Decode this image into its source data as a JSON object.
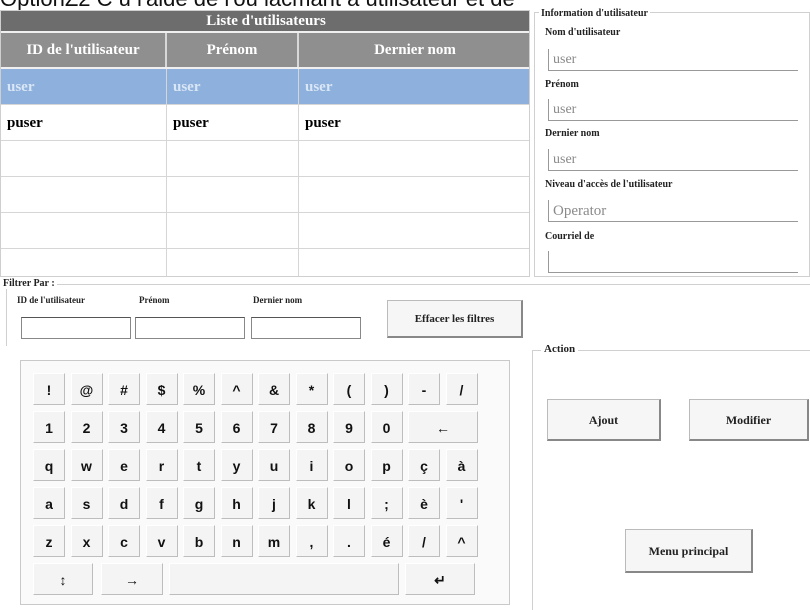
{
  "caption": "OptionZ2 C u l'aide de l'ou lacmant a utilisateur et de",
  "users_list": {
    "title": "Liste d'utilisateurs",
    "columns": [
      "ID de l'utilisateur",
      "Prénom",
      "Dernier nom"
    ],
    "rows": [
      [
        "user",
        "user",
        "user"
      ],
      [
        "puser",
        "puser",
        "puser"
      ],
      [
        "",
        "",
        ""
      ],
      [
        "",
        "",
        ""
      ],
      [
        "",
        "",
        ""
      ],
      [
        "",
        "",
        ""
      ]
    ],
    "selected_row": 0
  },
  "user_info": {
    "legend": "Information d'utilisateur",
    "username_label": "Nom d'utilisateur",
    "username_value": "user",
    "firstname_label": "Prénom",
    "firstname_value": "user",
    "lastname_label": "Dernier nom",
    "lastname_value": "user",
    "access_label": "Niveau d'accès de l'utilisateur",
    "access_value": "Operator",
    "email_label": "Courriel de",
    "email_value": ""
  },
  "filter": {
    "legend": "Filtrer Par :",
    "id_label": "ID de l'utilisateur",
    "firstname_label": "Prénom",
    "lastname_label": "Dernier nom",
    "id_value": "",
    "firstname_value": "",
    "lastname_value": "",
    "clear_label": "Effacer les filtres"
  },
  "keyboard": {
    "rows": [
      [
        "!",
        "@",
        "#",
        "$",
        "%",
        "^",
        "&",
        "*",
        "(",
        ")",
        "-",
        "/"
      ],
      [
        "1",
        "2",
        "3",
        "4",
        "5",
        "6",
        "7",
        "8",
        "9",
        "0",
        "←"
      ],
      [
        "q",
        "w",
        "e",
        "r",
        "t",
        "y",
        "u",
        "i",
        "o",
        "p",
        "ç",
        "à"
      ],
      [
        "a",
        "s",
        "d",
        "f",
        "g",
        "h",
        "j",
        "k",
        "l",
        ";",
        "è",
        "'"
      ],
      [
        "z",
        "x",
        "c",
        "v",
        "b",
        "n",
        "m",
        ",",
        ".",
        "é",
        "/",
        "^"
      ],
      [
        "↕",
        "→",
        "",
        "↵"
      ]
    ]
  },
  "action": {
    "legend": "Action",
    "add_label": "Ajout",
    "modify_label": "Modifier",
    "main_menu_label": "Menu principal"
  }
}
